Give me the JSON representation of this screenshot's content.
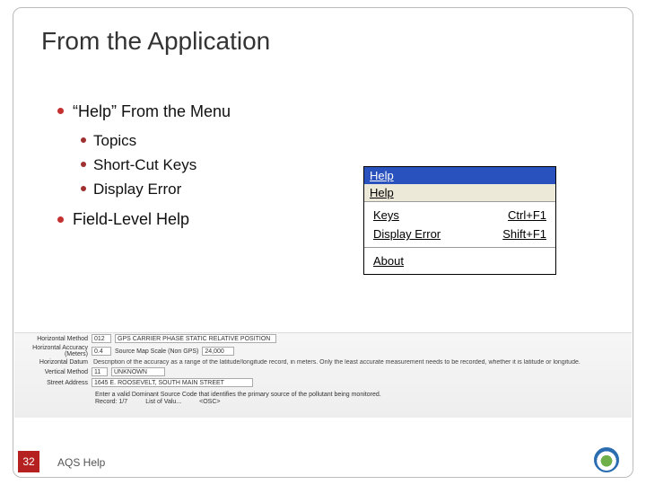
{
  "slide": {
    "title": "From the Application",
    "bullets": {
      "lvl1a": "“Help” From the Menu",
      "sub1": "Topics",
      "sub2": "Short-Cut Keys",
      "sub3": "Display Error",
      "lvl1b": "Field-Level Help"
    }
  },
  "menu": {
    "header_selected": "Help",
    "header": "Help",
    "items": [
      {
        "label": "Keys",
        "accel": "Ctrl+F1"
      },
      {
        "label": "Display Error",
        "accel": "Shift+F1"
      }
    ],
    "about": "About"
  },
  "form": {
    "rows": {
      "r1_label": "Horizontal Method",
      "r1_v1": "012",
      "r1_v2": "GPS CARRIER PHASE STATIC RELATIVE POSITION",
      "r2_label": "Horizontal Accuracy (Meters)",
      "r2_v1": "0.4",
      "r2_mid": "Source Map Scale (Non GPS)",
      "r2_v2": "24,000",
      "r3_label": "Horizontal Datum",
      "r3_desc": "Description of the accuracy as a range of the latitude/longitude record, in meters. Only the least accurate measurement needs to be recorded, whether it is latitude or longitude.",
      "r4_label": "Vertical Method",
      "r4_v1": "11",
      "r4_v2": "UNKNOWN",
      "r5_label": "Street Address",
      "r5_v1": "1645 E. ROOSEVELT, SOUTH MAIN STREET"
    },
    "hint": "Enter a valid Dominant Source Code that identifies the primary source of the pollutant being monitored.",
    "footer": {
      "rec": "Record: 1/7",
      "lov": "List of Valu...",
      "osc": "<OSC>"
    }
  },
  "footer": {
    "num": "32",
    "text": "AQS Help"
  }
}
